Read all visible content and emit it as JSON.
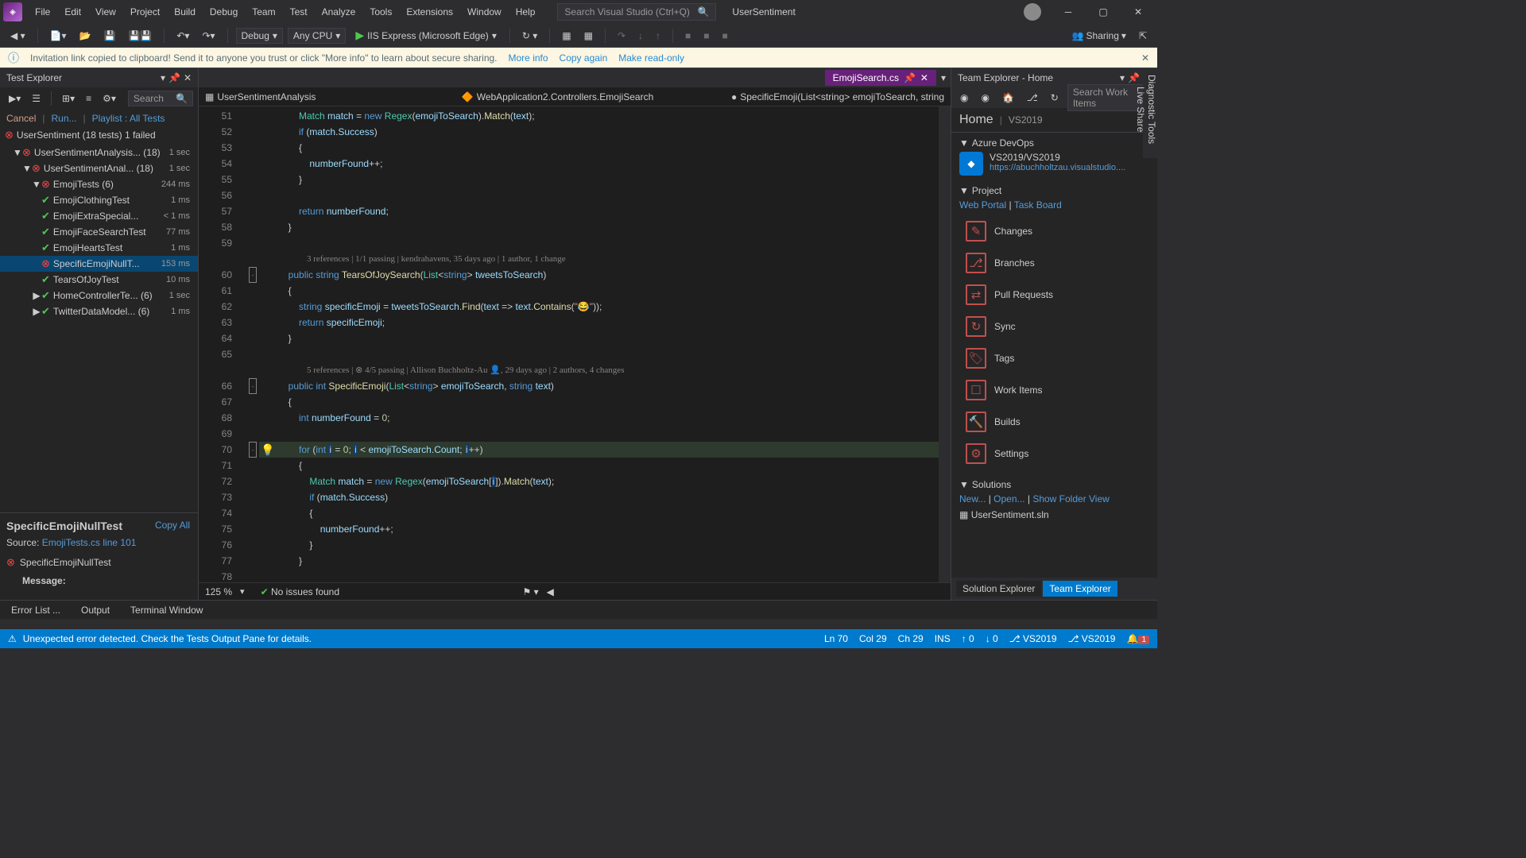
{
  "menubar": [
    "File",
    "Edit",
    "View",
    "Project",
    "Build",
    "Debug",
    "Team",
    "Test",
    "Analyze",
    "Tools",
    "Extensions",
    "Window",
    "Help"
  ],
  "search_placeholder": "Search Visual Studio (Ctrl+Q)",
  "app_title": "UserSentiment",
  "toolbar": {
    "config": "Debug",
    "platform": "Any CPU",
    "run": "IIS Express (Microsoft Edge)",
    "sharing": "Sharing"
  },
  "info_bar": {
    "text": "Invitation link copied to clipboard! Send it to anyone you trust or click \"More info\" to learn about secure sharing.",
    "more": "More info",
    "copy": "Copy again",
    "readonly": "Make read-only"
  },
  "test_explorer": {
    "title": "Test Explorer",
    "search_ph": "Search",
    "links": {
      "cancel": "Cancel",
      "run": "Run...",
      "playlist": "Playlist : All Tests"
    },
    "root": {
      "name": "UserSentiment (18 tests) 1 failed"
    },
    "tree": [
      {
        "indent": 1,
        "status": "fail",
        "name": "UserSentimentAnalysis...",
        "count": "(18)",
        "time": "1 sec",
        "chev": "▼"
      },
      {
        "indent": 2,
        "status": "fail",
        "name": "UserSentimentAnal...",
        "count": "(18)",
        "time": "1 sec",
        "chev": "▼"
      },
      {
        "indent": 3,
        "status": "fail",
        "name": "EmojiTests (6)",
        "time": "244 ms",
        "chev": "▼"
      },
      {
        "indent": 4,
        "status": "pass",
        "name": "EmojiClothingTest",
        "time": "1 ms"
      },
      {
        "indent": 4,
        "status": "pass",
        "name": "EmojiExtraSpecial...",
        "time": "< 1 ms"
      },
      {
        "indent": 4,
        "status": "pass",
        "name": "EmojiFaceSearchTest",
        "time": "77 ms"
      },
      {
        "indent": 4,
        "status": "pass",
        "name": "EmojiHeartsTest",
        "time": "1 ms"
      },
      {
        "indent": 4,
        "status": "fail",
        "name": "SpecificEmojiNullT...",
        "time": "153 ms",
        "selected": true
      },
      {
        "indent": 4,
        "status": "pass",
        "name": "TearsOfJoyTest",
        "time": "10 ms"
      },
      {
        "indent": 3,
        "status": "pass",
        "name": "HomeControllerTe...",
        "count": "(6)",
        "time": "1 sec",
        "chev": "▶"
      },
      {
        "indent": 3,
        "status": "pass",
        "name": "TwitterDataModel...",
        "count": "(6)",
        "time": "1 ms",
        "chev": "▶"
      }
    ],
    "detail": {
      "title": "SpecificEmojiNullTest",
      "copy": "Copy All",
      "source_label": "Source:",
      "source": "EmojiTests.cs line 101",
      "fail_name": "SpecificEmojiNullTest",
      "message": "Message:"
    }
  },
  "editor": {
    "tab": "EmojiSearch.cs",
    "breadcrumb": {
      "proj": "UserSentimentAnalysis",
      "ns": "WebApplication2.Controllers.EmojiSearch",
      "method": "SpecificEmoji(List<string> emojiToSearch, string"
    },
    "first_line": 51,
    "codelens1": "3 references | 1/1 passing | kendrahavens, 35 days ago | 1 author, 1 change",
    "codelens2": "5 references | ⊗ 4/5 passing | Allison Buchholtz-Au 👤, 29 days ago | 2 authors, 4 changes",
    "status": {
      "zoom": "125 %",
      "issues": "No issues found"
    }
  },
  "team_explorer": {
    "title": "Team Explorer - Home",
    "search_ph": "Search Work Items",
    "home": "Home",
    "home_sub": "VS2019",
    "azure": {
      "heading": "Azure DevOps",
      "proj": "VS2019/VS2019",
      "url": "https://abuchholtzau.visualstudio...."
    },
    "project": {
      "heading": "Project",
      "links": [
        "Web Portal",
        "Task Board"
      ],
      "items": [
        "Changes",
        "Branches",
        "Pull Requests",
        "Sync",
        "Tags",
        "Work Items",
        "Builds",
        "Settings"
      ]
    },
    "solutions": {
      "heading": "Solutions",
      "links": [
        "New...",
        "Open...",
        "Show Folder View"
      ],
      "sln": "UserSentiment.sln"
    },
    "tabs": {
      "se": "Solution Explorer",
      "te": "Team Explorer"
    }
  },
  "right_rail": [
    "Diagnostic Tools",
    "Live Share"
  ],
  "output_tabs": [
    "Error List ...",
    "Output",
    "Terminal Window"
  ],
  "status_bar": {
    "err": "Unexpected error detected. Check the Tests Output Pane for details.",
    "ln": "Ln 70",
    "col": "Col 29",
    "ch": "Ch 29",
    "ins": "INS",
    "up": "↑ 0",
    "down": "↓ 0",
    "repo": "VS2019",
    "branch": "VS2019",
    "notif": "1"
  }
}
